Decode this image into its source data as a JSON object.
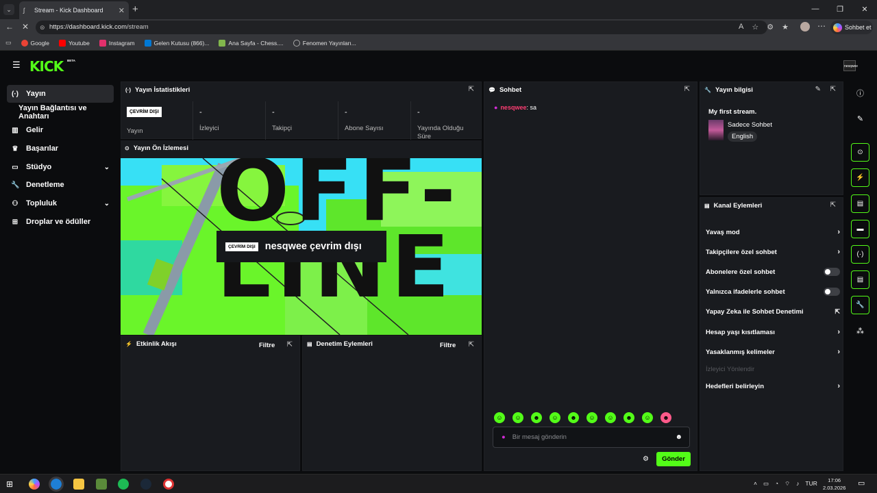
{
  "browser": {
    "tab_title": "Stream - Kick Dashboard",
    "url_host": "https://dashboard.kick.com",
    "url_path": "/stream",
    "copilot_label": "Sohbet et",
    "bookmarks": [
      {
        "label": "Google",
        "icon": "google-icon",
        "color": "#ea4335"
      },
      {
        "label": "Youtube",
        "icon": "youtube-icon",
        "color": "#ff0000"
      },
      {
        "label": "Instagram",
        "icon": "instagram-icon",
        "color": "#e1306c"
      },
      {
        "label": "Gelen Kutusu (866)...",
        "icon": "mail-icon",
        "color": "#0078d4"
      },
      {
        "label": "Ana Sayfa - Chess....",
        "icon": "chess-icon",
        "color": "#81b64c"
      },
      {
        "label": "Fenomen Yayınları...",
        "icon": "globe-icon",
        "color": "#aaaaaa"
      }
    ]
  },
  "app": {
    "logo": "KICK",
    "logo_badge": "BETA",
    "avatar_text": "nesqwee",
    "accent": "#53fc18"
  },
  "sidebar": {
    "items": [
      {
        "label": "Yayın",
        "icon": "broadcast-icon",
        "active": true
      },
      {
        "label": "Yayın Bağlantısı ve Anahtarı",
        "icon": "",
        "sub": true
      },
      {
        "label": "Gelir",
        "icon": "chart-icon"
      },
      {
        "label": "Başarılar",
        "icon": "trophy-icon"
      },
      {
        "label": "Stüdyo",
        "icon": "studio-icon",
        "expandable": true
      },
      {
        "label": "Denetleme",
        "icon": "wrench-icon"
      },
      {
        "label": "Topluluk",
        "icon": "people-icon",
        "expandable": true
      },
      {
        "label": "Droplar ve ödüller",
        "icon": "gift-icon"
      }
    ]
  },
  "stats": {
    "title": "Yayın İstatistikleri",
    "offline_badge": "ÇEVRİM DIŞI",
    "cells": [
      {
        "value": "",
        "label": "Yayın"
      },
      {
        "value": "-",
        "label": "İzleyici"
      },
      {
        "value": "-",
        "label": "Takipçi"
      },
      {
        "value": "-",
        "label": "Abone Sayısı"
      },
      {
        "value": "-",
        "label": "Yayında Olduğu Süre"
      }
    ]
  },
  "preview": {
    "title": "Yayın Ön İzlemesi",
    "big_text": "OFF-LINE",
    "badge": "ÇEVRİM DIŞI",
    "channel_status": "nesqwee çevrim dışı"
  },
  "activity": {
    "title": "Etkinlik Akışı",
    "filter": "Filtre"
  },
  "moderation": {
    "title": "Denetim Eylemleri",
    "filter": "Filtre"
  },
  "chat": {
    "title": "Sohbet",
    "messages": [
      {
        "user": "nesqwee",
        "text": ": sa"
      }
    ],
    "placeholder": "Bir mesaj gönderin",
    "send_label": "Gönder",
    "emote_count": 10
  },
  "stream_info": {
    "title": "Yayın bilgisi",
    "stream_title": "My first stream.",
    "category": "Sadece Sohbet",
    "language": "English"
  },
  "channel_actions": {
    "title": "Kanal Eylemleri",
    "items": [
      {
        "label": "Yavaş mod",
        "type": "arrow"
      },
      {
        "label": "Takipçilere özel sohbet",
        "type": "arrow"
      },
      {
        "label": "Abonelere özel sohbet",
        "type": "toggle"
      },
      {
        "label": "Yalnızca ifadelerle sohbet",
        "type": "toggle"
      },
      {
        "label": "Yapay Zeka ile Sohbet Denetimi",
        "type": "external"
      },
      {
        "label": "Hesap yaşı kısıtlaması",
        "type": "arrow"
      },
      {
        "label": "Yasaklanmış kelimeler",
        "type": "arrow"
      },
      {
        "label": "İzleyici Yönlendir",
        "type": "disabled"
      },
      {
        "label": "Hedefleri belirleyin",
        "type": "arrow"
      }
    ]
  },
  "taskbar": {
    "lang": "TUR",
    "time": "17:06",
    "date": "2.03.2026"
  }
}
